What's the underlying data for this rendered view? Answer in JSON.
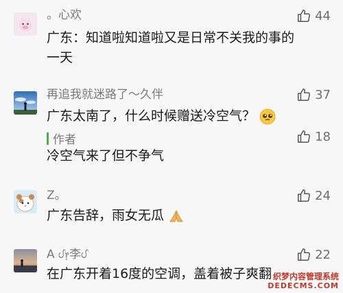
{
  "comments": [
    {
      "name": "。心欢",
      "text": "广东：知道啦知道啦又是日常不关我的事的一天",
      "likes": "44",
      "avatar_icon": "pig-avatar-icon"
    },
    {
      "name": "再追我就迷路了～久伴",
      "text": "广东太南了，什么时候赠送冷空气？",
      "likes": "37",
      "avatar_icon": "sky-silhouette-avatar-icon",
      "emoji": "pleading-face-emoji",
      "reply": {
        "label": "作者",
        "text": "冷空气来了但不争气",
        "likes": "18"
      }
    },
    {
      "name": "Z。",
      "text": "广东告辞，雨女无瓜",
      "likes": "24",
      "avatar_icon": "hamster-avatar-icon",
      "emoji": "praying-hands-emoji"
    },
    {
      "name": "A ᦔ᥅李ᦔ",
      "text": "在广东开着16度的空调，盖着被子爽翻",
      "likes": "22",
      "avatar_icon": "sunset-person-avatar-icon"
    }
  ],
  "watermark": {
    "line1": "织梦内容管理系统",
    "line2": "DEDECMS.COM"
  },
  "colors": {
    "background": "#f7f7f7",
    "author_bar": "#46b04d",
    "text": "#1a1a1a",
    "meta": "#7a7a7a"
  }
}
